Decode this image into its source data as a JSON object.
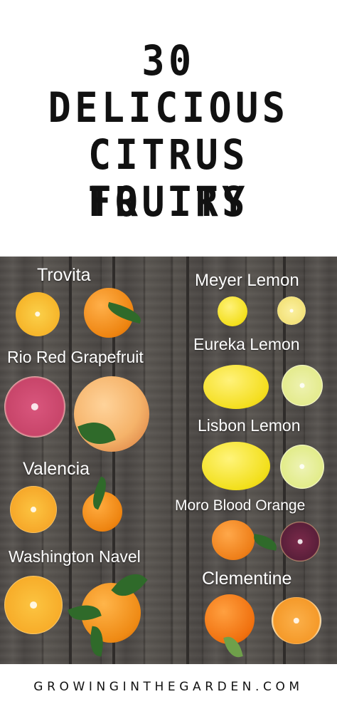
{
  "title": {
    "line1": "30",
    "line2": "DELICIOUS",
    "line3": "CITRUS FRUITS",
    "line4": "TO TRY"
  },
  "fruits": {
    "trovita": "Trovita",
    "rio_red": "Rio Red Grapefruit",
    "valencia": "Valencia",
    "washington_navel": "Washington Navel",
    "meyer_lemon": "Meyer Lemon",
    "eureka_lemon": "Eureka Lemon",
    "lisbon_lemon": "Lisbon Lemon",
    "moro_blood_orange": "Moro Blood Orange",
    "clementine": "Clementine"
  },
  "footer": {
    "site": "GROWINGINTHEGARDEN.COM"
  },
  "colors": {
    "title_text": "#111111",
    "label_text": "#ffffff",
    "background_wood": "#4d4946",
    "orange": "#f08a12",
    "lemon": "#f2dd1e",
    "grapefruit_flesh": "#c8456a",
    "blood_orange_flesh": "#5a1f3a",
    "leaf": "#2f6a2a"
  }
}
